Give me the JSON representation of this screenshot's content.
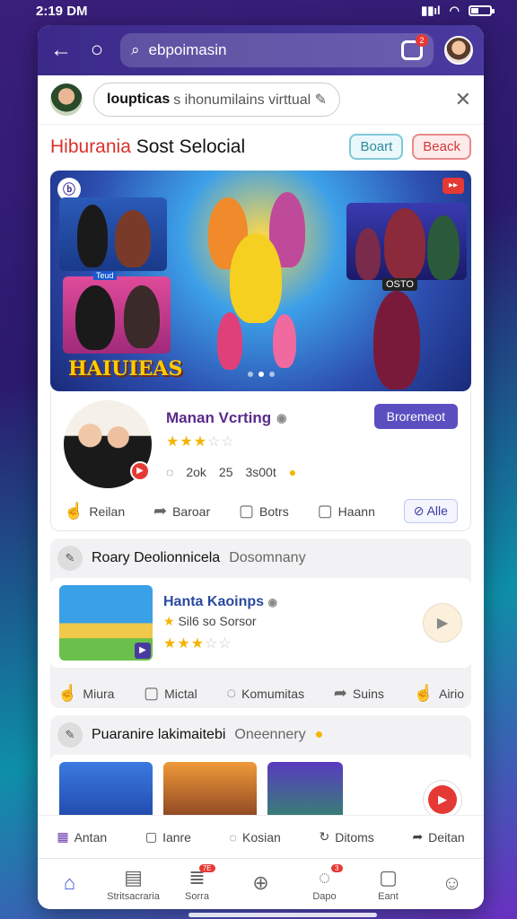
{
  "status": {
    "time": "2:19 DM"
  },
  "topbar": {
    "search_text": "ebpoimasin",
    "cam_badge": "2"
  },
  "prompt": {
    "bold": "loupticas",
    "rest": "s ihonumilains virttual ✎"
  },
  "section": {
    "title_accent": "Hiburania",
    "title_rest": "Sost Selocial",
    "btn1": "Boart",
    "btn2": "Beack"
  },
  "hero": {
    "logo": "HAIUIEAS",
    "badge_left": "ⓑ",
    "badge_right": "▸▸",
    "tag_small": "Teud",
    "tag_right": "OSTO"
  },
  "feature": {
    "name": "Manan Vcrting",
    "stars": "★★★",
    "stars_off": "☆☆",
    "stat1": "2ok",
    "stat2": "25",
    "stat3": "3s00t",
    "cta": "Broremeot",
    "actions": [
      "Reilan",
      "Baroar",
      "Botrs",
      "Haann"
    ],
    "chip": "Alle"
  },
  "group1": {
    "title": "Roary Deolionnicela",
    "muted": "Dosomnany",
    "item_title": "Hanta Kaoinps",
    "item_sub": "Sil6 so Sorsor",
    "stars": "★★★",
    "stars_off": "☆☆",
    "actions": [
      "Miura",
      "Mictal",
      "Komumitas",
      "Suins",
      "Airio"
    ]
  },
  "group2": {
    "title": "Puaranire lakimaitebi",
    "muted": "Oneennery"
  },
  "bottom_actions": [
    "Antan",
    "Ianre",
    "Kosian",
    "Ditoms",
    "Deitan"
  ],
  "tabs": [
    {
      "label": "",
      "icon": "home-icon"
    },
    {
      "label": "Stritsacraria",
      "icon": "store-icon"
    },
    {
      "label": "Sorra",
      "icon": "stack-icon",
      "badge": "7E"
    },
    {
      "label": "",
      "icon": "compass-icon"
    },
    {
      "label": "Dapo",
      "icon": "chat-icon",
      "badge": "3"
    },
    {
      "label": "Eant",
      "icon": "device-icon"
    },
    {
      "label": "",
      "icon": "profile-icon"
    }
  ]
}
